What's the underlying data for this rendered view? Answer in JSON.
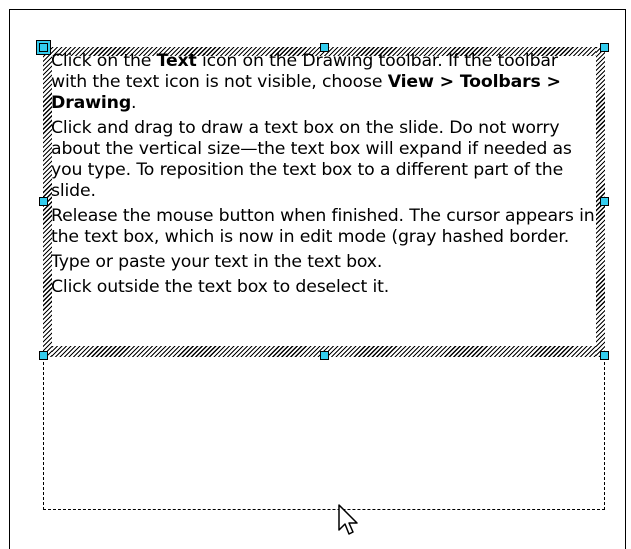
{
  "paragraphs": [
    {
      "prefix": "Click on the ",
      "bold1": "Text",
      "mid": " icon  on the Drawing toolbar. If the toolbar with the text icon is not visible, choose ",
      "bold2": "View > Toolbars > Drawing",
      "suffix": "."
    },
    {
      "text": "Click and drag to draw a text box on the slide. Do not worry about the vertical size—the text box will expand if needed as you type. To reposition  the text box to a different part of the slide."
    },
    {
      "text": "Release the mouse button when finished. The cursor appears in the text box, which is now in edit mode (gray hashed border."
    },
    {
      "text": "Type or paste your text in the text box."
    },
    {
      "text": "Click outside the text box to deselect it."
    }
  ],
  "colors": {
    "handle": "#33ccee",
    "hatch": "#000000"
  },
  "icons": {
    "cursor": "mouse-pointer-icon"
  }
}
